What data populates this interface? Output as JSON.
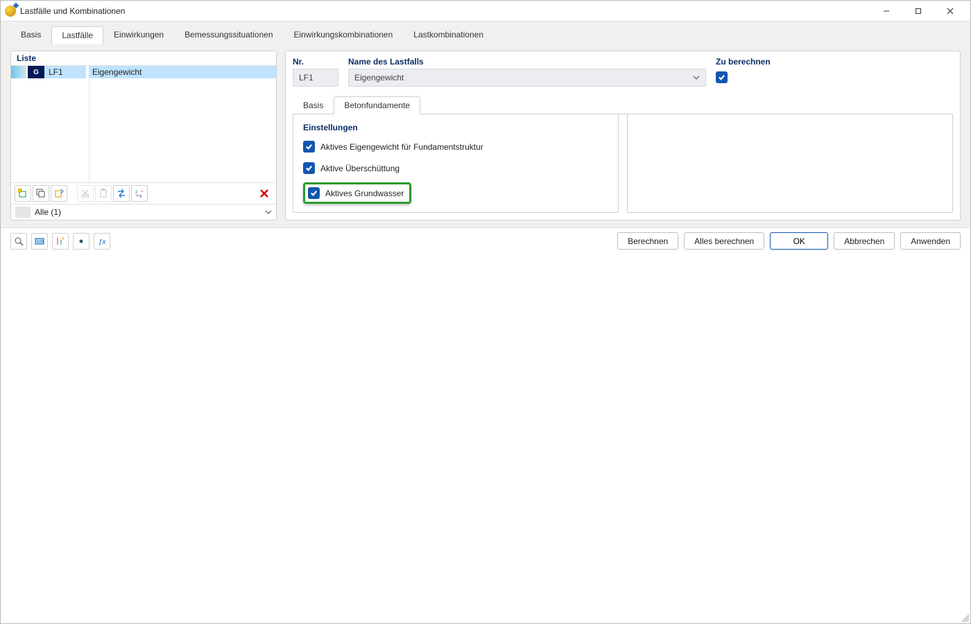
{
  "window": {
    "title": "Lastfälle und Kombinationen"
  },
  "mainTabs": {
    "basis": "Basis",
    "lastfaelle": "Lastfälle",
    "einwirkungen": "Einwirkungen",
    "bemessung": "Bemessungssituationen",
    "einwkomb": "Einwirkungskombinationen",
    "lastkomb": "Lastkombinationen"
  },
  "left": {
    "header": "Liste",
    "row": {
      "badge": "G",
      "lf": "LF1",
      "name": "Eigengewicht"
    },
    "filter": "Alle (1)"
  },
  "fields": {
    "nrLabel": "Nr.",
    "nrValue": "LF1",
    "nameLabel": "Name des Lastfalls",
    "nameValue": "Eigengewicht",
    "calcLabel": "Zu berechnen"
  },
  "subTabs": {
    "basis": "Basis",
    "beton": "Betonfundamente"
  },
  "settings": {
    "title": "Einstellungen",
    "opt1": "Aktives Eigengewicht für Fundamentstruktur",
    "opt2": "Aktive Überschüttung",
    "opt3": "Aktives Grundwasser"
  },
  "buttons": {
    "berechnen": "Berechnen",
    "allesBerechnen": "Alles berechnen",
    "ok": "OK",
    "abbrechen": "Abbrechen",
    "anwenden": "Anwenden"
  }
}
